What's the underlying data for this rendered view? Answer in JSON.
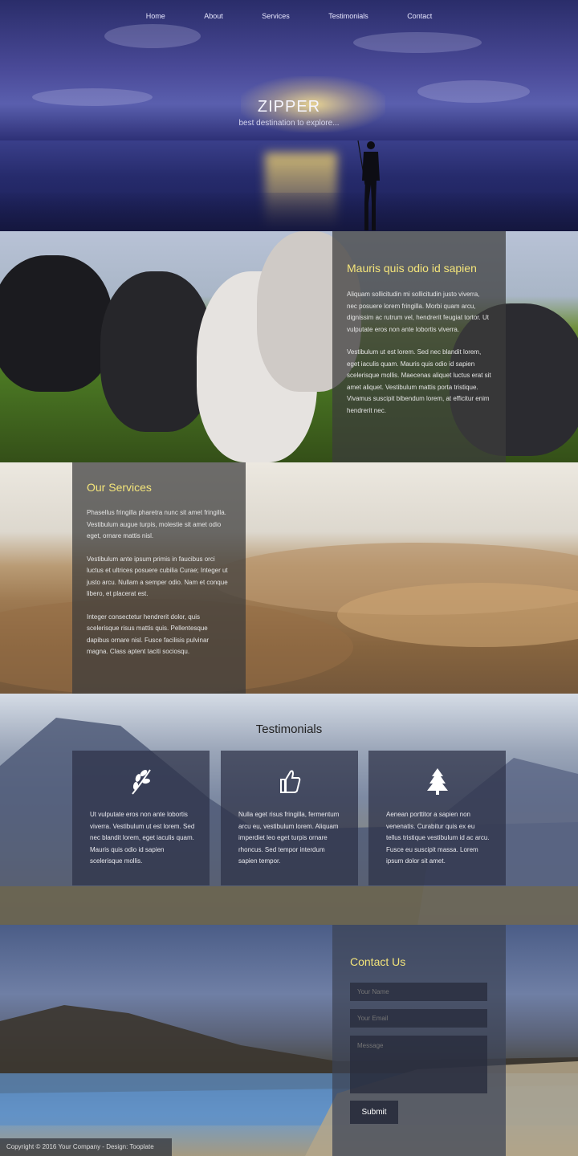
{
  "nav": {
    "items": [
      "Home",
      "About",
      "Services",
      "Testimonials",
      "Contact"
    ]
  },
  "hero": {
    "title": "ZIPPER",
    "subtitle": "best destination to explore..."
  },
  "about": {
    "title": "Mauris quis odio id sapien",
    "p1": "Aliquam sollicitudin mi sollicitudin justo viverra, nec posuere lorem fringilla. Morbi quam arcu, dignissim ac rutrum vel, hendrerit feugiat tortor. Ut vulputate eros non ante lobortis viverra.",
    "p2": "Vestibulum ut est lorem. Sed nec blandit lorem, eget iaculis quam. Mauris quis odio id sapien scelerisque mollis. Maecenas aliquet luctus erat sit amet aliquet. Vestibulum mattis porta tristique. Vivamus suscipit bibendum lorem, at efficitur enim hendrerit nec."
  },
  "services": {
    "title": "Our Services",
    "p1": "Phasellus fringilla pharetra nunc sit amet fringilla. Vestibulum augue turpis, molestie sit amet odio eget, ornare mattis nisl.",
    "p2": "Vestibulum ante ipsum primis in faucibus orci luctus et ultrices posuere cubilia Curae; Integer ut justo arcu. Nullam a semper odio. Nam et conque libero, et placerat est.",
    "p3": "Integer consectetur hendrerit dolor, quis scelerisque risus mattis quis. Pellentesque dapibus ornare nisl. Fusce facilisis pulvinar magna. Class aptent taciti sociosqu."
  },
  "testimonials": {
    "title": "Testimonials",
    "cards": [
      {
        "icon": "leaf-icon",
        "text": "Ut vulputate eros non ante lobortis viverra. Vestibulum ut est lorem. Sed nec blandit lorem, eget iaculis quam. Mauris quis odio id sapien scelerisque mollis."
      },
      {
        "icon": "thumbs-up-icon",
        "text": "Nulla eget risus fringilla, fermentum arcu eu, vestibulum lorem. Aliquam imperdiet leo eget turpis ornare rhoncus. Sed tempor interdum sapien tempor."
      },
      {
        "icon": "tree-icon",
        "text": "Aenean porttitor a sapien non venenatis. Curabitur quis ex eu tellus tristique vestibulum id ac arcu. Fusce eu suscipit massa. Lorem ipsum dolor sit amet."
      }
    ]
  },
  "contact": {
    "title": "Contact Us",
    "name_placeholder": "Your Name",
    "email_placeholder": "Your Email",
    "message_placeholder": "Message",
    "submit_label": "Submit"
  },
  "footer": {
    "copyright": "Copyright © 2016 Your Company - Design: Tooplate"
  },
  "colors": {
    "accent": "#f3e47a",
    "panel": "#3c3c3c"
  }
}
